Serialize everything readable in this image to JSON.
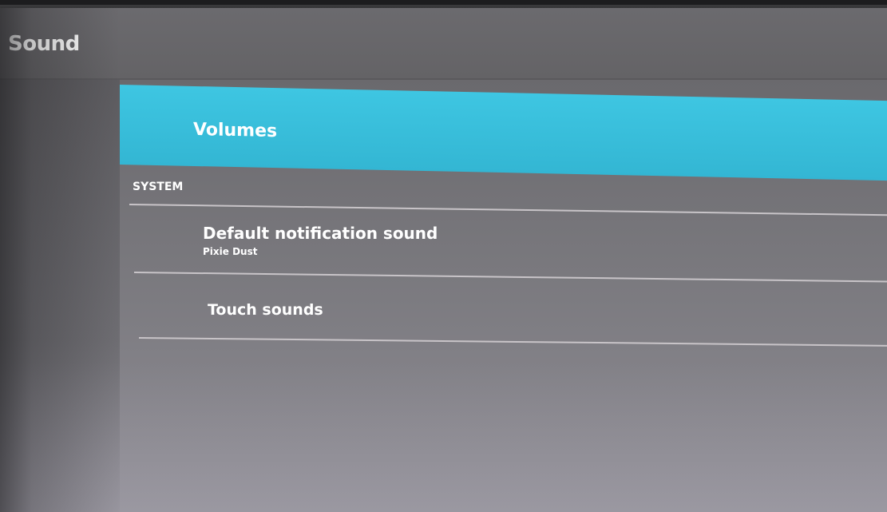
{
  "action_bar": {
    "title": "Sound"
  },
  "list": {
    "volumes": {
      "label": "Volumes",
      "selected": true,
      "highlight_color": "#3ec6e2"
    },
    "section_header": "SYSTEM",
    "items": [
      {
        "title": "Default notification sound",
        "summary": "Pixie Dust"
      },
      {
        "title": "Touch sounds"
      }
    ]
  }
}
